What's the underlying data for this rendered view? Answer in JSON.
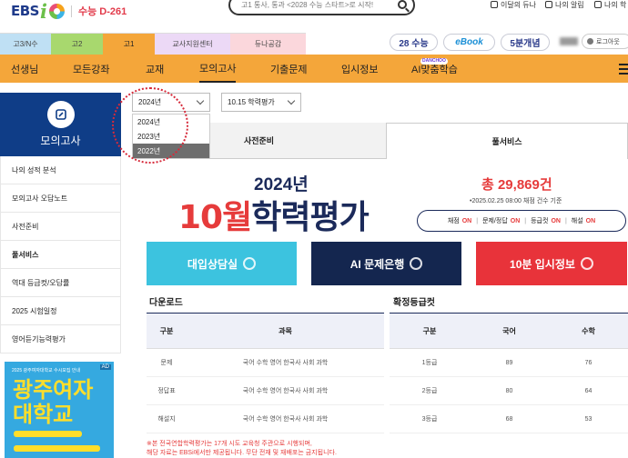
{
  "header": {
    "logo": "EBS",
    "dday": "수능 D-261",
    "search_placeholder": "고1 통사, 통과 <2028 수능 스타트>로 시작!",
    "util": [
      "이달의 듀나",
      "나의 알림",
      "나의 학"
    ]
  },
  "grade_tabs": [
    "고3/N수",
    "고2",
    "고1",
    "교사지원센터",
    "듀나공감"
  ],
  "quick_links": [
    "28 수능",
    "eBook",
    "5분개념"
  ],
  "logout_label": "로그아웃",
  "nav": [
    "선생님",
    "모든강좌",
    "교재",
    "모의고사",
    "기출문제",
    "입시정보",
    "AI맞춤학습"
  ],
  "nav_ai_badge": "DANCHOO",
  "sidebar": {
    "title": "모의고사",
    "items": [
      "나의 성적 분석",
      "모의고사 오답노트",
      "사전준비",
      "풀서비스",
      "역대 등급컷/오답률",
      "2025 시험일정",
      "영어듣기능력평가"
    ]
  },
  "ad": {
    "tag": "AD",
    "small": "2025 광주여자대학교 수시모집 안내",
    "big": "광주여자\n대학교"
  },
  "filters": {
    "year_value": "2024년",
    "exam_value": "10.15 학력평가",
    "year_options": [
      "2024년",
      "2023년",
      "2022년"
    ],
    "highlighted_option": "2022년"
  },
  "content_tabs": [
    "사전준비",
    "풀서비스"
  ],
  "banner": {
    "year": "2024년",
    "title_red": "10월",
    "title_navy": "학력평가",
    "total": "총 29,869건",
    "total_sub": "•2025.02.25 08:00 채점 건수 기준",
    "status": [
      {
        "label": "채점",
        "value": "ON"
      },
      {
        "label": "문제/정답",
        "value": "ON"
      },
      {
        "label": "등급컷",
        "value": "ON"
      },
      {
        "label": "해설",
        "value": "ON"
      }
    ]
  },
  "tiles": [
    "대입상담실",
    "AI 문제은행",
    "10분 입시정보"
  ],
  "download": {
    "title": "다운로드",
    "headers": [
      "구분",
      "과목"
    ],
    "rows": [
      [
        "문제",
        "국어 수학 영어 한국사 사회 과학"
      ],
      [
        "정답표",
        "국어 수학 영어 한국사 사회 과학"
      ],
      [
        "해설지",
        "국어 수학 영어 한국사 사회 과학"
      ]
    ]
  },
  "cuts": {
    "title": "확정등급컷",
    "headers": [
      "구분",
      "국어",
      "수학"
    ],
    "rows": [
      [
        "1등급",
        "89",
        "76"
      ],
      [
        "2등급",
        "80",
        "64"
      ],
      [
        "3등급",
        "68",
        "53"
      ]
    ]
  },
  "note": "※본 전국연합학력평가는 17개 시도 교육청 주관으로 시행되며,\n해당 자료는 EBSi에서만 제공됩니다. 무단 전재 및 재배포는 금지됩니다."
}
